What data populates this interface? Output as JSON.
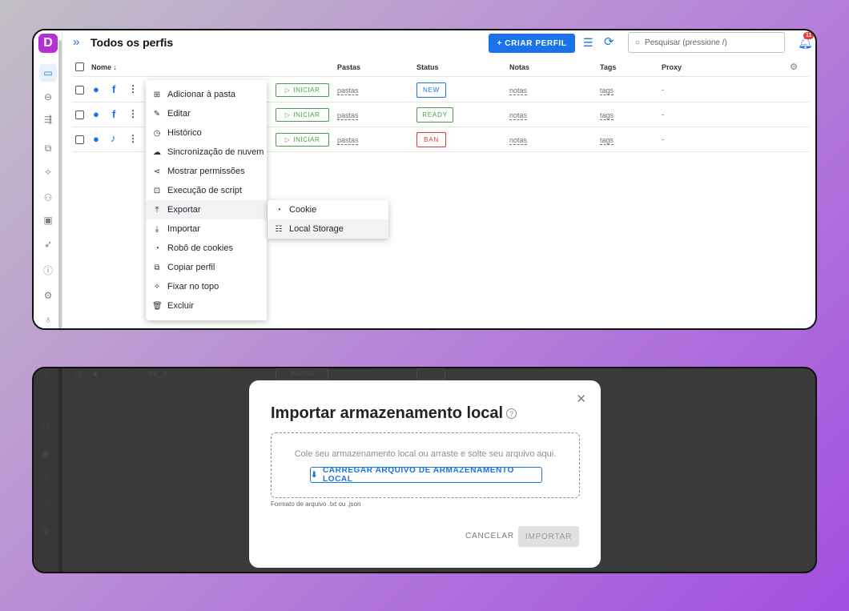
{
  "app": {
    "logo": "D",
    "page_title": "Todos os perfis"
  },
  "toolbar": {
    "create_label": "+ CRIAR PERFIL",
    "search_placeholder": "Pesquisar (pressione /)",
    "notifications_count": "11"
  },
  "sidebar": {
    "icons": [
      "profiles-icon",
      "link-icon",
      "proxy-icon",
      "copy-icon",
      "extensions-icon",
      "team-icon",
      "api-icon",
      "rocket-icon",
      "help-icon",
      "settings-icon",
      "bulb-icon"
    ]
  },
  "table": {
    "columns": {
      "name": "Nome ↓",
      "folders": "Pastas",
      "status": "Status",
      "notes": "Notas",
      "tags": "Tags",
      "proxy": "Proxy"
    },
    "rows": [
      {
        "os": "apple",
        "social": "f",
        "start": "INICIAR",
        "folders": "pastas",
        "status": "NEW",
        "status_color": "#1a73e8",
        "notes": "notas",
        "tags": "tags",
        "proxy": "-"
      },
      {
        "os": "apple",
        "social": "f",
        "start": "INICIAR",
        "folders": "pastas",
        "status": "READY",
        "status_color": "#43a047",
        "notes": "notas",
        "tags": "tags",
        "proxy": "-"
      },
      {
        "os": "apple",
        "social": "tiktok",
        "start": "INICIAR",
        "folders": "pastas",
        "status": "BAN",
        "status_color": "#e53935",
        "notes": "notas",
        "tags": "tags",
        "proxy": "-"
      }
    ]
  },
  "context_menu": {
    "items": [
      {
        "label": "Adicionar à pasta",
        "icon": "folder-add-icon"
      },
      {
        "label": "Editar",
        "icon": "edit-icon"
      },
      {
        "label": "Histórico",
        "icon": "history-icon"
      },
      {
        "label": "Sincronização de nuvem",
        "icon": "cloud-icon"
      },
      {
        "label": "Mostrar permissões",
        "icon": "share-icon"
      },
      {
        "label": "Execução de script",
        "icon": "terminal-icon"
      },
      {
        "label": "Exportar",
        "icon": "export-icon"
      },
      {
        "label": "Importar",
        "icon": "import-icon"
      },
      {
        "label": "Robô de cookies",
        "icon": "cookie-robot-icon"
      },
      {
        "label": "Copiar perfil",
        "icon": "copy-icon"
      },
      {
        "label": "Fixar no topo",
        "icon": "pin-icon"
      },
      {
        "label": "Excluir",
        "icon": "trash-icon"
      }
    ],
    "submenu": [
      {
        "label": "Cookie",
        "icon": "cookie-icon"
      },
      {
        "label": "Local Storage",
        "icon": "storage-icon"
      }
    ]
  },
  "background_row": {
    "name": "FB_3",
    "start": "INICIAR"
  },
  "modal": {
    "title": "Importar armazenamento local",
    "drop_text": "Cole seu armazenamento local ou arraste e solte seu arquivo aqui.",
    "upload_label": "CARREGAR ARQUIVO DE ARMAZENAMENTO LOCAL",
    "format_note": "Formato de arquivo .txt ou .json",
    "cancel_label": "CANCELAR",
    "import_label": "IMPORTAR"
  }
}
